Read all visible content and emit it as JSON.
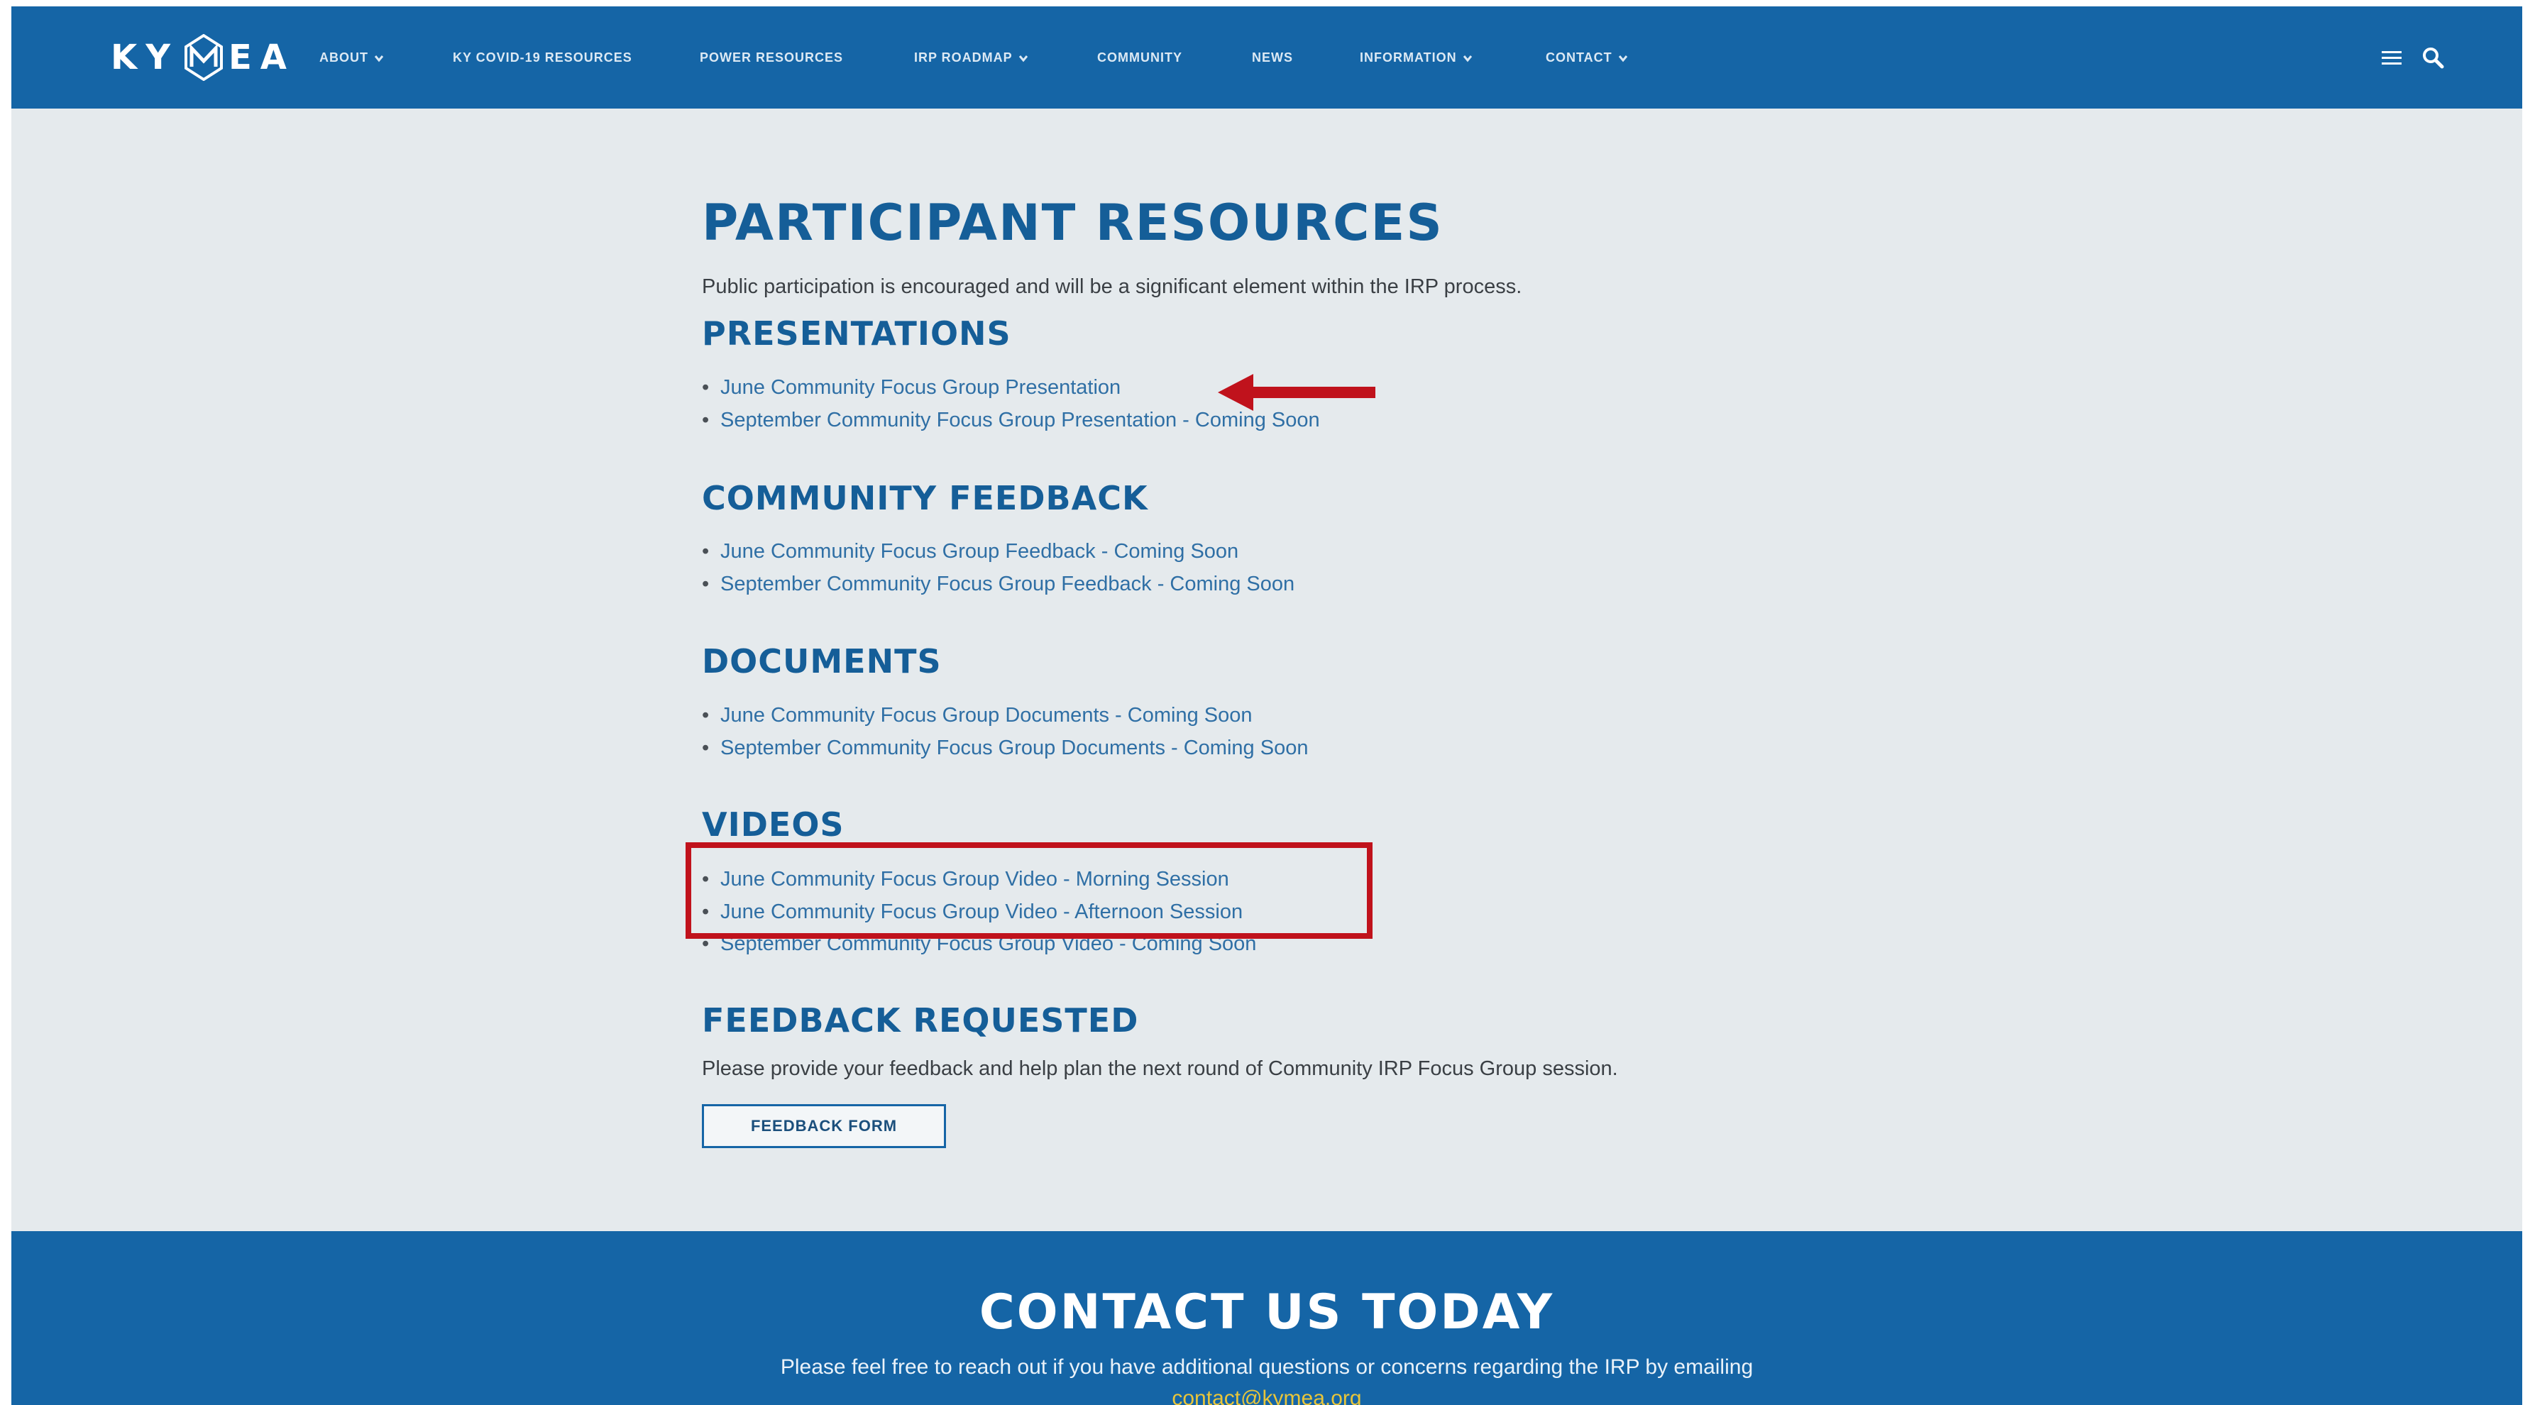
{
  "header": {
    "logo_text_left": "KY",
    "logo_text_right": "EA",
    "nav": [
      {
        "label": "ABOUT",
        "dropdown": true
      },
      {
        "label": "KY COVID-19 RESOURCES",
        "dropdown": false
      },
      {
        "label": "POWER RESOURCES",
        "dropdown": false
      },
      {
        "label": "IRP ROADMAP",
        "dropdown": true
      },
      {
        "label": "COMMUNITY",
        "dropdown": false
      },
      {
        "label": "NEWS",
        "dropdown": false
      },
      {
        "label": "INFORMATION",
        "dropdown": true
      },
      {
        "label": "CONTACT",
        "dropdown": true
      }
    ],
    "menu_icon": "hamburger-menu-icon",
    "search_icon": "search-icon"
  },
  "main": {
    "title": "PARTICIPANT RESOURCES",
    "intro": "Public participation is encouraged and will be a significant element within the IRP process.",
    "sections": [
      {
        "heading": "PRESENTATIONS",
        "links": [
          "June Community Focus Group Presentation",
          "September Community Focus Group Presentation - Coming Soon"
        ]
      },
      {
        "heading": "COMMUNITY FEEDBACK",
        "links": [
          "June Community Focus Group Feedback - Coming Soon",
          "September Community Focus Group Feedback - Coming Soon"
        ]
      },
      {
        "heading": "DOCUMENTS",
        "links": [
          "June Community Focus Group Documents - Coming Soon",
          "September Community Focus Group Documents - Coming Soon"
        ]
      },
      {
        "heading": "VIDEOS",
        "links": [
          "June Community Focus Group Video - Morning Session",
          "June Community Focus Group Video - Afternoon Session",
          "September Community Focus Group Video - Coming Soon"
        ]
      }
    ],
    "feedback": {
      "heading": "FEEDBACK REQUESTED",
      "text": "Please provide your feedback and help plan the next round of Community IRP Focus Group session.",
      "button_label": "FEEDBACK FORM"
    }
  },
  "footer": {
    "title": "CONTACT US TODAY",
    "text": "Please feel free to reach out if you have additional questions or concerns regarding the IRP by emailing",
    "email": "contact@kymea.org"
  },
  "colors": {
    "brand_blue": "#1565a6",
    "heading_blue": "#155e98",
    "link_blue": "#2f6fa5",
    "annotation_red": "#c0121c",
    "footer_link": "#e8c53a"
  }
}
